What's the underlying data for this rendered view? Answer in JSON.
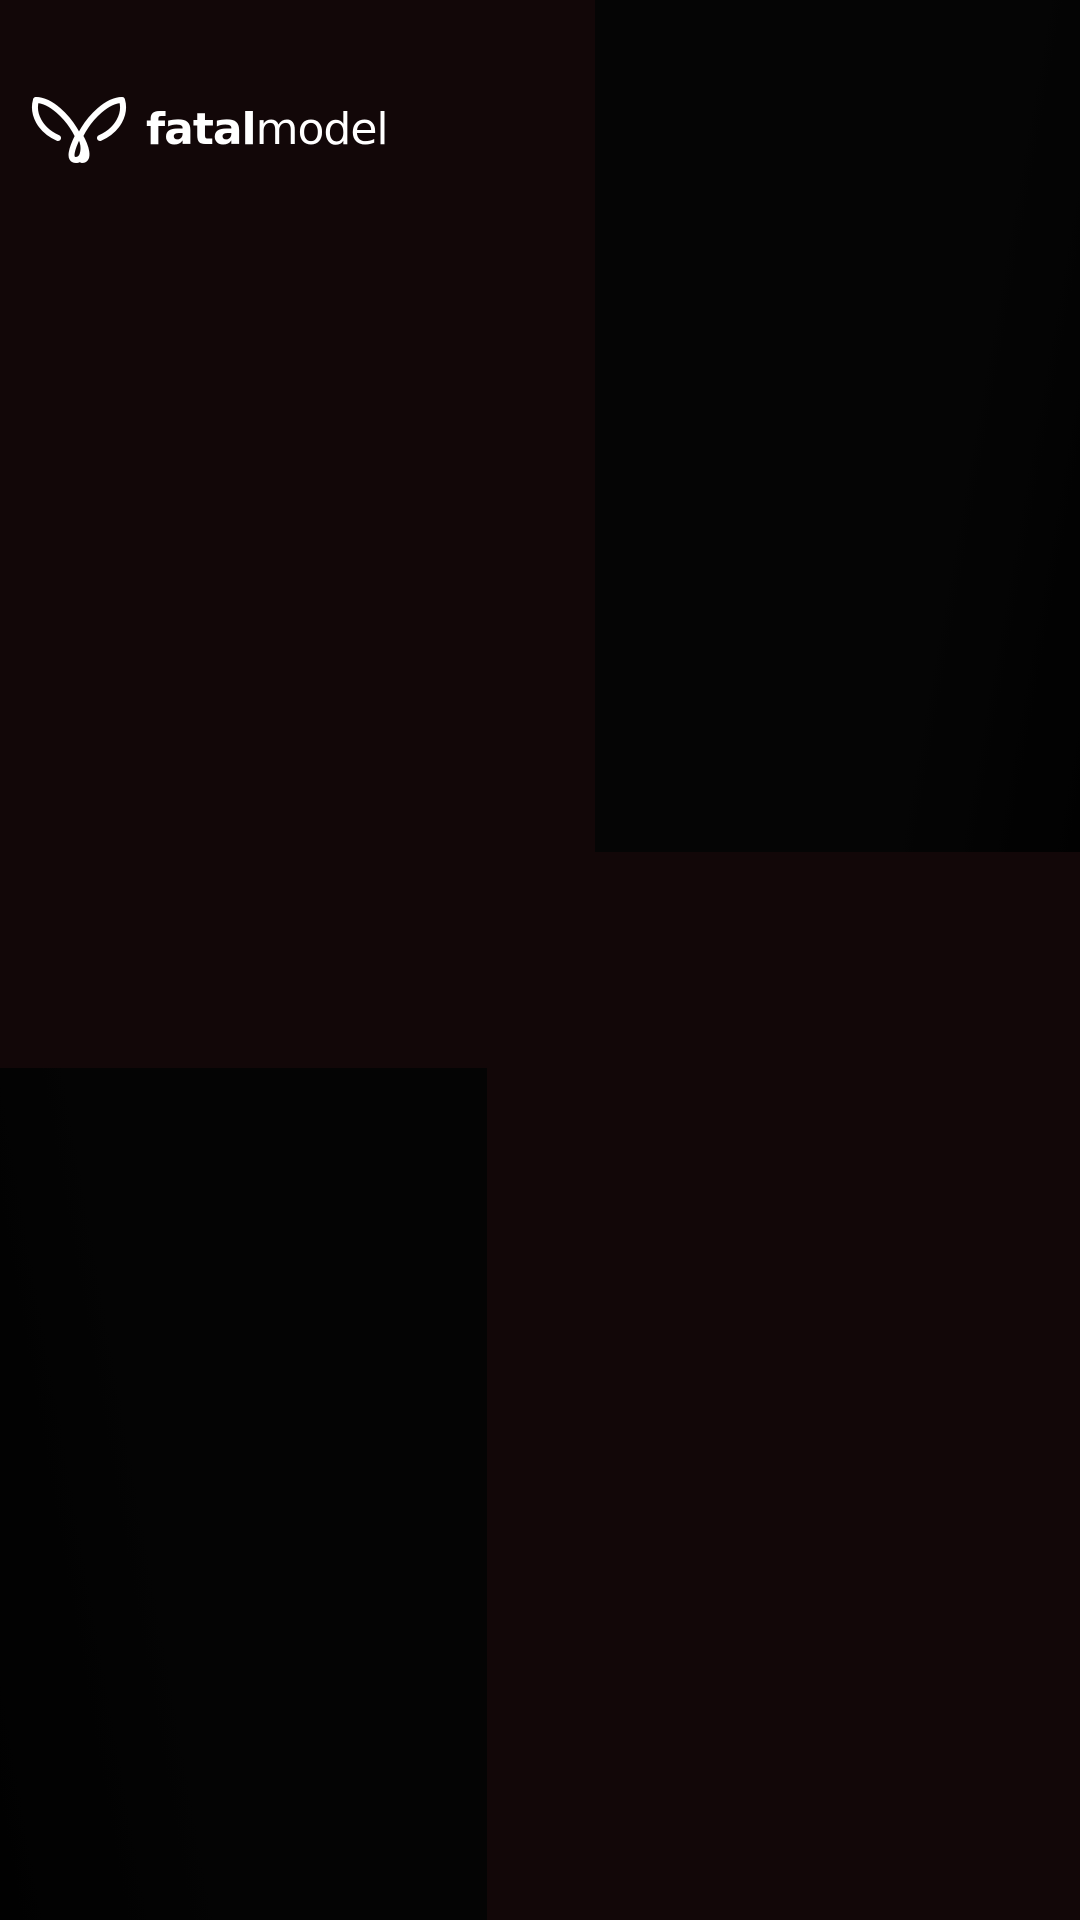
{
  "brand": {
    "name_bold": "fatal",
    "name_light": "model",
    "logo_icon": "butterfly-icon",
    "text_color": "#ffffff"
  },
  "colors": {
    "background": "#120708",
    "photo_panel": "#030303"
  }
}
